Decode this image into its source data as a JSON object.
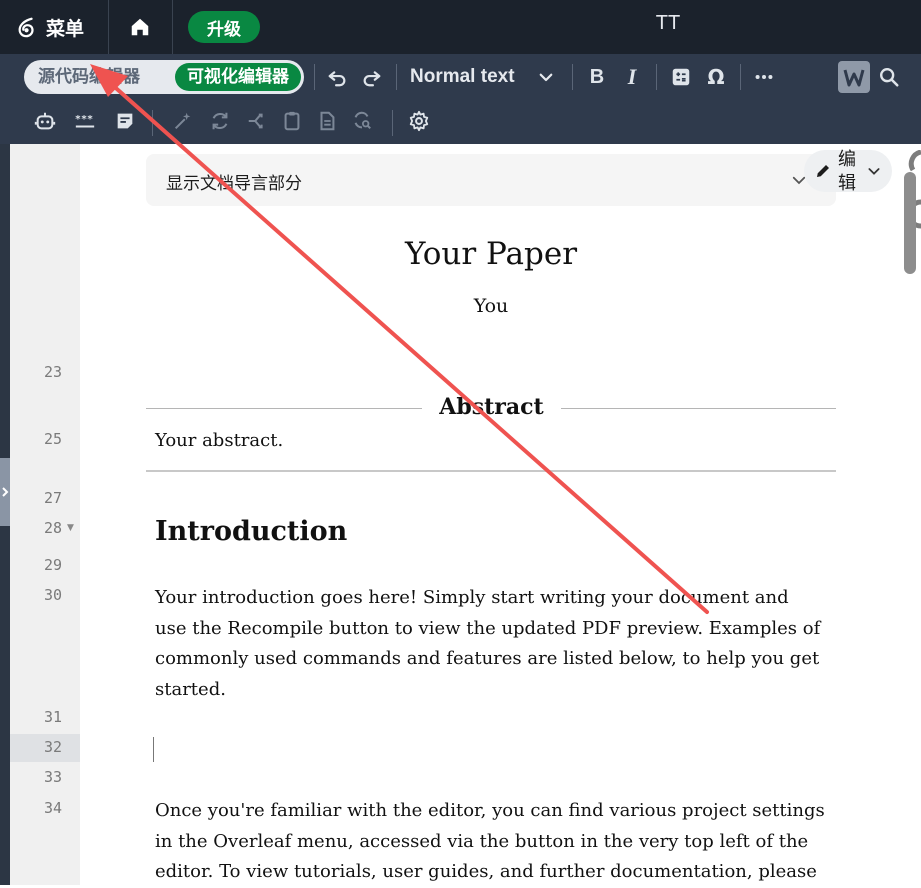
{
  "topbar": {
    "menu_label": "菜单",
    "upgrade_label": "升级",
    "project_title": "TT"
  },
  "toolbar": {
    "source_editor_label": "源代码编辑器",
    "visual_editor_label": "可视化编辑器",
    "text_style": "Normal text",
    "icons": [
      "undo-icon",
      "redo-icon",
      "chevron-down-icon",
      "bold-icon",
      "italic-icon",
      "math-icon",
      "omega-icon",
      "more-icon",
      "writefull-icon",
      "search-icon",
      "robot-icon",
      "password-icon",
      "note-icon",
      "magic-icon",
      "refresh-icon",
      "compare-icon",
      "clipboard-icon",
      "document-icon",
      "search-replace-icon",
      "settings-icon"
    ]
  },
  "editor": {
    "preamble_label": "显示文档导言部分",
    "edit_label": "编辑",
    "line_numbers": [
      "23",
      "25",
      "27",
      "28",
      "29",
      "30",
      "31",
      "32",
      "33",
      "34"
    ],
    "active_line": "32",
    "document": {
      "title": "Your Paper",
      "author": "You",
      "abstract_heading": "Abstract",
      "abstract_text": "Your abstract.",
      "section_title": "Introduction",
      "paragraph1": "Your introduction goes here! Simply start writing your document and use the Recompile button to view the updated PDF preview. Examples of commonly used commands and features are listed below, to help you get started.",
      "paragraph2": "Once you're familiar with the editor, you can find various project settings in the Overleaf menu, accessed via the button in the very top left of the editor. To view tutorials, user guides, and further documentation, please"
    }
  },
  "annotation": {
    "arrow_color": "#ef5350"
  },
  "colors": {
    "accent_green": "#098842",
    "topbar_bg": "#1b222c",
    "toolbar_bg": "#2f3a4c"
  }
}
